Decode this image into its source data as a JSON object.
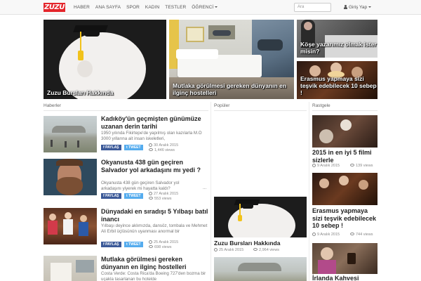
{
  "brand": {
    "logo_text": "ZUZU",
    "accent": "#e4252b"
  },
  "nav": {
    "items": [
      "HABER",
      "ANA SAYFA",
      "SPOR",
      "KADIN",
      "TESTLER",
      "ÖĞRENCİ"
    ],
    "search_placeholder": "Ara",
    "login_label": "Giriş Yap"
  },
  "hero": [
    {
      "title": "Zuzu Bursları Hakkında"
    },
    {
      "title": "Mutlaka görülmesi gereken dünyanın en ilginç hostelleri"
    },
    {
      "title": "Köşe yazarımız olmak ister misin?"
    },
    {
      "title": "Erasmus yapmaya sizi teşvik edebilecek 10 sebep !"
    }
  ],
  "columns": {
    "news_title": "Haberler",
    "popular_title": "Popüler",
    "random_title": "Rastgele"
  },
  "news": [
    {
      "title": "Kadıköy'ün geçmişten günümüze uzanan derin tarihi",
      "excerpt": "1950 yılında Fikirtepe'de yapılmış olan kazılarla M.Ö 3000 yıllarına ait insan iskeletleri,",
      "share_fb": "PAYLAŞ",
      "share_tw": "TWEET",
      "date": "30 Aralık 2015",
      "views": "1,446 views"
    },
    {
      "title": "Okyanusta 438 gün geçiren Salvador yol arkadaşını mı yedi ?",
      "excerpt": "Okyanusta 438 gün geçiren Salvador yol arkadaşını yiyerek mi hayatta kaldı?",
      "share_fb": "PAYLAŞ",
      "share_tw": "TWEET",
      "date": "27 Aralık 2015",
      "views": "553 views"
    },
    {
      "title": "Dünyadaki en sıradışı 5 Yılbaşı batıl inancı",
      "excerpt": "Yılbaşı deyince aklımızda, dansöz, tombala ve Mehmet Ali Erbil üçlüsünün uyanması anormal bir",
      "share_fb": "PAYLAŞ",
      "share_tw": "TWEET",
      "date": "25 Aralık 2015",
      "views": "698 views"
    },
    {
      "title": "Mutlaka görülmesi gereken dünyanın en ilginç hostelleri",
      "excerpt": "Costa Verde: Costa Rica'da Boeing 727'den bozma bir uçakla tasarlanan bu hotelde",
      "share_fb": "PAYLAŞ",
      "share_tw": "TWEET",
      "date": "",
      "views": ""
    }
  ],
  "popular": [
    {
      "title": "Zuzu Bursları Hakkında",
      "date": "25 Aralık 2015",
      "views": "2,964 views"
    }
  ],
  "random": [
    {
      "title": "2015 in en iyi 5 filmi sizlerle",
      "date": "9 Aralık 2015",
      "views": "139 views"
    },
    {
      "title": "Erasmus yapmaya sizi teşvik edebilecek 10 sebep !",
      "date": "9 Aralık 2015",
      "views": "744 views"
    },
    {
      "title": "İrlanda Kahvesi",
      "date": "",
      "views": ""
    }
  ],
  "ellipsis": "..."
}
